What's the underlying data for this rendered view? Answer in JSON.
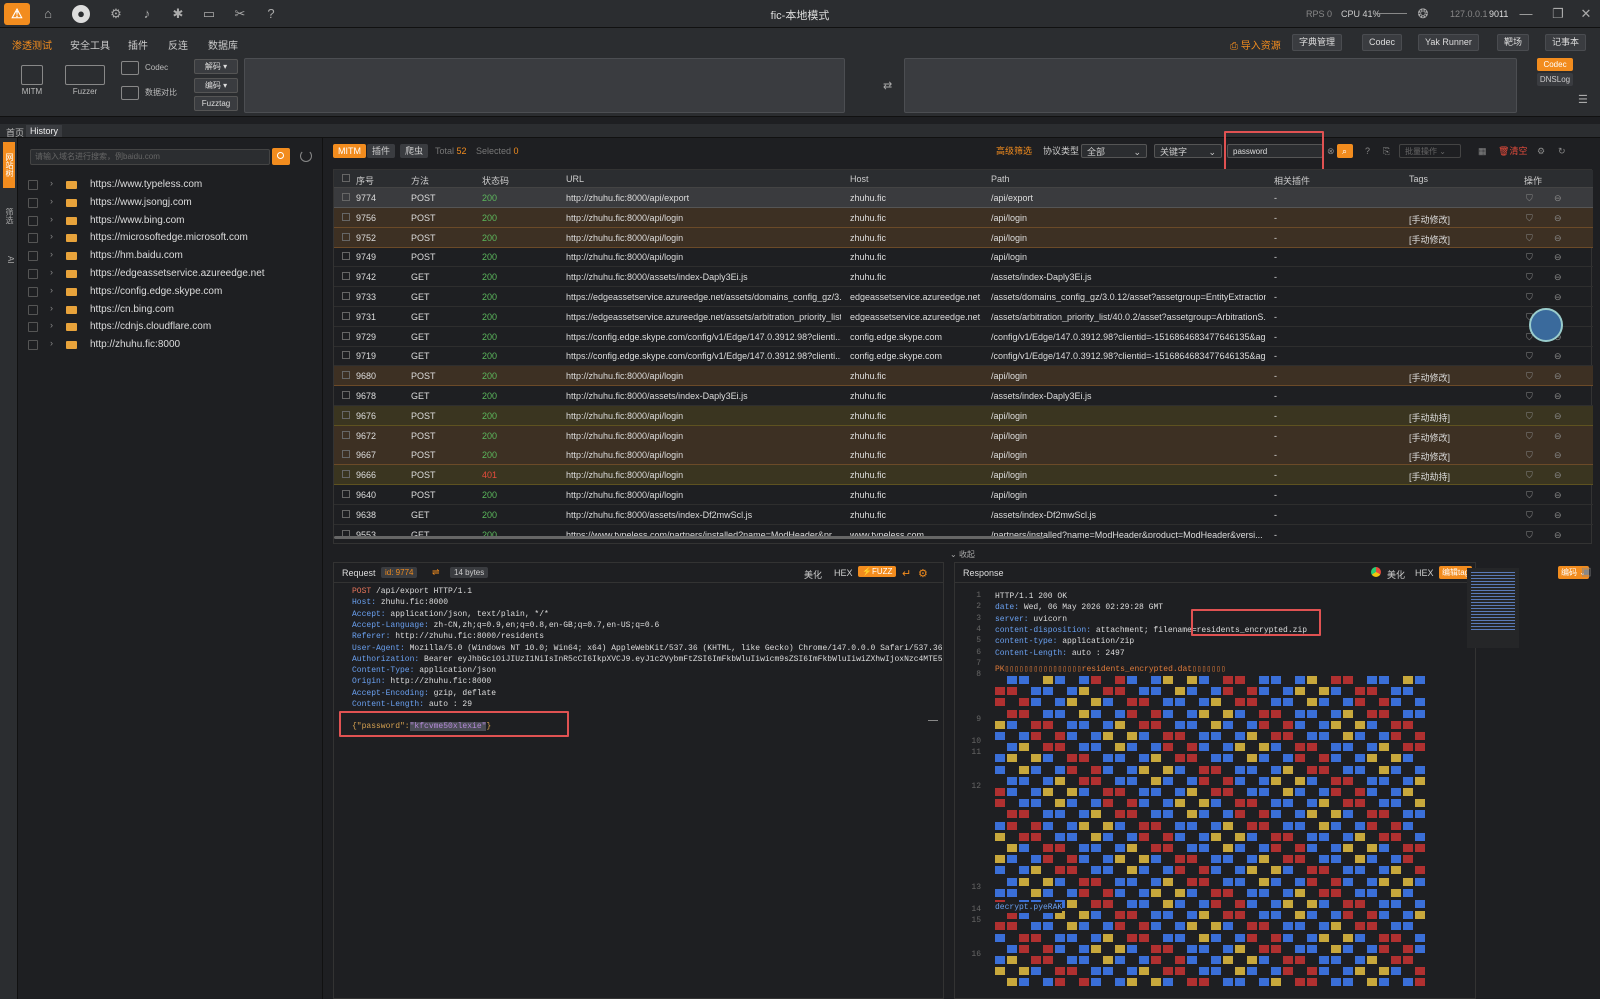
{
  "title": "fic-本地模式",
  "status": {
    "rps_label": "RPS 0",
    "cpu_label": "CPU 41%",
    "ip": "127.0.0.1",
    "port": "9011"
  },
  "menu": [
    "渗透测试",
    "安全工具",
    "插件",
    "反连",
    "数据库"
  ],
  "header_buttons": [
    "导入资源",
    "字典管理",
    "Codec",
    "Yak Runner",
    "靶场",
    "记事本"
  ],
  "toolbar": {
    "mitm": "MITM",
    "fuzzer": "Fuzzer",
    "codec": "Codec",
    "compare": "数据对比",
    "decode": "解码",
    "encode": "编码",
    "fuzztag": "Fuzztag",
    "codec_btn": "Codec",
    "dnslog_btn": "DNSLog"
  },
  "tabs": [
    "首页",
    "History"
  ],
  "strip": [
    "网站树",
    "筛选",
    "AI"
  ],
  "sidebar": {
    "search_placeholder": "请输入域名进行搜索，例baidu.com",
    "sites": [
      "https://www.typeless.com",
      "https://www.jsongj.com",
      "https://www.bing.com",
      "https://microsoftedge.microsoft.com",
      "https://hm.baidu.com",
      "https://edgeassetservice.azureedge.net",
      "https://config.edge.skype.com",
      "https://cn.bing.com",
      "https://cdnjs.cloudflare.com",
      "http://zhuhu.fic:8000"
    ]
  },
  "filter": {
    "mitm": "MITM",
    "plugin": "插件",
    "crawler": "爬虫",
    "total_label": "Total",
    "total": "52",
    "selected_label": "Selected",
    "selected": "0",
    "advanced": "高级筛选",
    "protocol_label": "协议类型",
    "protocol_value": "全部",
    "keyword_type": "关键字",
    "keyword": "password",
    "batch": "批量操作",
    "clear": "清空"
  },
  "columns": [
    "序号",
    "方法",
    "状态码",
    "URL",
    "Host",
    "Path",
    "相关插件",
    "Tags",
    "操作"
  ],
  "rows": [
    {
      "id": "9774",
      "method": "POST",
      "status": "200",
      "url": "http://zhuhu.fic:8000/api/export",
      "host": "zhuhu.fic",
      "path": "/api/export",
      "plugin": "-",
      "tag": "",
      "hl": "sel"
    },
    {
      "id": "9756",
      "method": "POST",
      "status": "200",
      "url": "http://zhuhu.fic:8000/api/login",
      "host": "zhuhu.fic",
      "path": "/api/login",
      "plugin": "-",
      "tag": "[手动修改]",
      "hl": "o"
    },
    {
      "id": "9752",
      "method": "POST",
      "status": "200",
      "url": "http://zhuhu.fic:8000/api/login",
      "host": "zhuhu.fic",
      "path": "/api/login",
      "plugin": "-",
      "tag": "[手动修改]",
      "hl": "o"
    },
    {
      "id": "9749",
      "method": "POST",
      "status": "200",
      "url": "http://zhuhu.fic:8000/api/login",
      "host": "zhuhu.fic",
      "path": "/api/login",
      "plugin": "-",
      "tag": "",
      "hl": ""
    },
    {
      "id": "9742",
      "method": "GET",
      "status": "200",
      "url": "http://zhuhu.fic:8000/assets/index-Daply3Ei.js",
      "host": "zhuhu.fic",
      "path": "/assets/index-Daply3Ei.js",
      "plugin": "-",
      "tag": "",
      "hl": ""
    },
    {
      "id": "9733",
      "method": "GET",
      "status": "200",
      "url": "https://edgeassetservice.azureedge.net/assets/domains_config_gz/3....",
      "host": "edgeassetservice.azureedge.net",
      "path": "/assets/domains_config_gz/3.0.12/asset?assetgroup=EntityExtraction...",
      "plugin": "-",
      "tag": "",
      "hl": ""
    },
    {
      "id": "9731",
      "method": "GET",
      "status": "200",
      "url": "https://edgeassetservice.azureedge.net/assets/arbitration_priority_list...",
      "host": "edgeassetservice.azureedge.net",
      "path": "/assets/arbitration_priority_list/40.0.2/asset?assetgroup=ArbitrationS...",
      "plugin": "-",
      "tag": "",
      "hl": ""
    },
    {
      "id": "9729",
      "method": "GET",
      "status": "200",
      "url": "https://config.edge.skype.com/config/v1/Edge/147.0.3912.98?clienti...",
      "host": "config.edge.skype.com",
      "path": "/config/v1/Edge/147.0.3912.98?clientid=-1516864683477646135&ag...",
      "plugin": "-",
      "tag": "",
      "hl": ""
    },
    {
      "id": "9719",
      "method": "GET",
      "status": "200",
      "url": "https://config.edge.skype.com/config/v1/Edge/147.0.3912.98?clienti...",
      "host": "config.edge.skype.com",
      "path": "/config/v1/Edge/147.0.3912.98?clientid=-1516864683477646135&ag...",
      "plugin": "-",
      "tag": "",
      "hl": ""
    },
    {
      "id": "9680",
      "method": "POST",
      "status": "200",
      "url": "http://zhuhu.fic:8000/api/login",
      "host": "zhuhu.fic",
      "path": "/api/login",
      "plugin": "-",
      "tag": "[手动修改]",
      "hl": "o"
    },
    {
      "id": "9678",
      "method": "GET",
      "status": "200",
      "url": "http://zhuhu.fic:8000/assets/index-Daply3Ei.js",
      "host": "zhuhu.fic",
      "path": "/assets/index-Daply3Ei.js",
      "plugin": "-",
      "tag": "",
      "hl": ""
    },
    {
      "id": "9676",
      "method": "POST",
      "status": "200",
      "url": "http://zhuhu.fic:8000/api/login",
      "host": "zhuhu.fic",
      "path": "/api/login",
      "plugin": "-",
      "tag": "[手动劫持]",
      "hl": "y"
    },
    {
      "id": "9672",
      "method": "POST",
      "status": "200",
      "url": "http://zhuhu.fic:8000/api/login",
      "host": "zhuhu.fic",
      "path": "/api/login",
      "plugin": "-",
      "tag": "[手动修改]",
      "hl": "o"
    },
    {
      "id": "9667",
      "method": "POST",
      "status": "200",
      "url": "http://zhuhu.fic:8000/api/login",
      "host": "zhuhu.fic",
      "path": "/api/login",
      "plugin": "-",
      "tag": "[手动修改]",
      "hl": "o"
    },
    {
      "id": "9666",
      "method": "POST",
      "status": "401",
      "url": "http://zhuhu.fic:8000/api/login",
      "host": "zhuhu.fic",
      "path": "/api/login",
      "plugin": "-",
      "tag": "[手动劫持]",
      "hl": "y"
    },
    {
      "id": "9640",
      "method": "POST",
      "status": "200",
      "url": "http://zhuhu.fic:8000/api/login",
      "host": "zhuhu.fic",
      "path": "/api/login",
      "plugin": "-",
      "tag": "",
      "hl": ""
    },
    {
      "id": "9638",
      "method": "GET",
      "status": "200",
      "url": "http://zhuhu.fic:8000/assets/index-Df2mwScl.js",
      "host": "zhuhu.fic",
      "path": "/assets/index-Df2mwScl.js",
      "plugin": "-",
      "tag": "",
      "hl": ""
    },
    {
      "id": "9553",
      "method": "GET",
      "status": "200",
      "url": "https://www.typeless.com/partners/installed?name=ModHeader&pr...",
      "host": "www.typeless.com",
      "path": "/partners/installed?name=ModHeader&product=ModHeader&versi...",
      "plugin": "-",
      "tag": "",
      "hl": ""
    }
  ],
  "collapse_label": "收起",
  "request": {
    "label": "Request",
    "id_badge": "id: 9774",
    "bytes": "14 bytes",
    "beautify": "美化",
    "hex": "HEX",
    "fuzz": "FUZZ",
    "lines": [
      {
        "k": "POST",
        "v": " /api/export HTTP/1.1"
      },
      {
        "k": "Host:",
        "v": " zhuhu.fic:8000"
      },
      {
        "k": "Accept:",
        "v": " application/json, text/plain, */*"
      },
      {
        "k": "Accept-Language:",
        "v": " zh-CN,zh;q=0.9,en;q=0.8,en-GB;q=0.7,en-US;q=0.6"
      },
      {
        "k": "Referer:",
        "v": " http://zhuhu.fic:8000/residents"
      },
      {
        "k": "User-Agent:",
        "v": " Mozilla/5.0 (Windows NT 10.0; Win64; x64) AppleWebKit/537.36 (KHTML, like Gecko) Chrome/147.0.0.0 Safari/537.36"
      },
      {
        "k": "Authorization:",
        "v": " Bearer eyJhbGciOiJIUzI1NiIsInR5cCI6IkpXVCJ9.eyJ1c2VybmFtZSI6ImFkbWluIiwicm9sZSI6ImFkbWluIiwiZXhwIjoxNzc4MTE5"
      },
      {
        "k": "Content-Type:",
        "v": " application/json"
      },
      {
        "k": "Origin:",
        "v": " http://zhuhu.fic:8000"
      },
      {
        "k": "Accept-Encoding:",
        "v": " gzip, deflate"
      },
      {
        "k": "Content-Length:",
        "v": " auto : 29"
      }
    ],
    "body_key": "{\"password\":",
    "body_value": "\"kfcvme50xlexie\"",
    "body_end": "}"
  },
  "response": {
    "label": "Response",
    "beautify": "美化",
    "hex": "HEX",
    "editor_tag": "编辑tag",
    "encode": "编码",
    "lines": [
      {
        "n": "1",
        "k": "HTTP/1.1 200 OK",
        "v": ""
      },
      {
        "n": "2",
        "k": "date:",
        "v": " Wed, 06 May 2026 02:29:28 GMT"
      },
      {
        "n": "3",
        "k": "server:",
        "v": " uvicorn"
      },
      {
        "n": "4",
        "k": "content-disposition:",
        "v": " attachment; filename=residents_encrypted.zip"
      },
      {
        "n": "5",
        "k": "content-type:",
        "v": " application/zip"
      },
      {
        "n": "6",
        "k": "Content-Length:",
        "v": " auto : 2497"
      }
    ],
    "zip_line": "PK▯▯▯▯▯▯▯▯▯▯▯▯▯▯▯▯residents_encrypted.dat▯▯▯▯▯▯▯",
    "decrypt_text": "decrypt.pyeRAK"
  }
}
